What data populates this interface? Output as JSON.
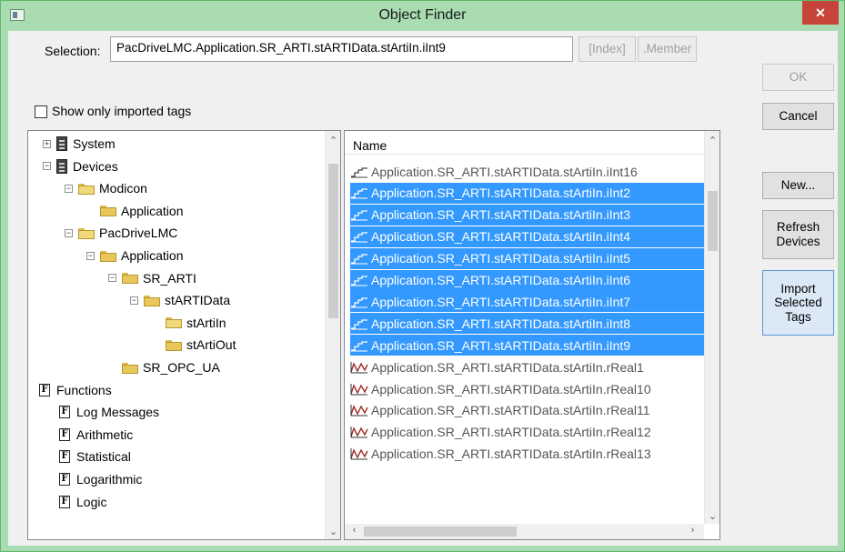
{
  "window": {
    "title": "Object Finder",
    "close_label": "✕"
  },
  "selection": {
    "label": "Selection:",
    "value": "PacDriveLMC.Application.SR_ARTI.stARTIData.stArtiIn.iInt9",
    "index_button": "[Index]",
    "member_button": ".Member"
  },
  "show_only_imported": {
    "label": "Show only imported tags",
    "checked": false
  },
  "buttons": {
    "ok": "OK",
    "cancel": "Cancel",
    "new": "New...",
    "refresh": "Refresh\nDevices",
    "import": "Import\nSelected\nTags"
  },
  "tree": [
    {
      "label": "System",
      "icon": "device-icon",
      "expander": "+",
      "indent": 0
    },
    {
      "label": "Devices",
      "icon": "device-icon",
      "expander": "−",
      "indent": 0
    },
    {
      "label": "Modicon",
      "icon": "folder-open-icon",
      "expander": "−",
      "indent": 1
    },
    {
      "label": "Application",
      "icon": "folder-icon",
      "expander": "",
      "indent": 2
    },
    {
      "label": "PacDriveLMC",
      "icon": "folder-open-icon",
      "expander": "−",
      "indent": 1
    },
    {
      "label": "Application",
      "icon": "folder-icon",
      "expander": "−",
      "indent": 2
    },
    {
      "label": "SR_ARTI",
      "icon": "folder-icon",
      "expander": "−",
      "indent": 3
    },
    {
      "label": "stARTIData",
      "icon": "folder-icon",
      "expander": "−",
      "indent": 4
    },
    {
      "label": "stArtiIn",
      "icon": "folder-open-icon",
      "expander": "",
      "indent": 5
    },
    {
      "label": "stArtiOut",
      "icon": "folder-icon",
      "expander": "",
      "indent": 5
    },
    {
      "label": "SR_OPC_UA",
      "icon": "folder-icon",
      "expander": "",
      "indent": 3
    },
    {
      "label": "Functions",
      "icon": "function-icon",
      "expander": "",
      "indent": 0
    },
    {
      "label": "Log Messages",
      "icon": "function-icon",
      "expander": "",
      "indent": 1
    },
    {
      "label": "Arithmetic",
      "icon": "function-icon",
      "expander": "",
      "indent": 1
    },
    {
      "label": "Statistical",
      "icon": "function-icon",
      "expander": "",
      "indent": 1
    },
    {
      "label": "Logarithmic",
      "icon": "function-icon",
      "expander": "",
      "indent": 1
    },
    {
      "label": "Logic",
      "icon": "function-icon",
      "expander": "",
      "indent": 1
    }
  ],
  "list": {
    "header": "Name",
    "rows": [
      {
        "name": "Application.SR_ARTI.stARTIData.stArtiIn.iInt16",
        "type": "int",
        "selected": false
      },
      {
        "name": "Application.SR_ARTI.stARTIData.stArtiIn.iInt2",
        "type": "int",
        "selected": true
      },
      {
        "name": "Application.SR_ARTI.stARTIData.stArtiIn.iInt3",
        "type": "int",
        "selected": true
      },
      {
        "name": "Application.SR_ARTI.stARTIData.stArtiIn.iInt4",
        "type": "int",
        "selected": true
      },
      {
        "name": "Application.SR_ARTI.stARTIData.stArtiIn.iInt5",
        "type": "int",
        "selected": true
      },
      {
        "name": "Application.SR_ARTI.stARTIData.stArtiIn.iInt6",
        "type": "int",
        "selected": true
      },
      {
        "name": "Application.SR_ARTI.stARTIData.stArtiIn.iInt7",
        "type": "int",
        "selected": true
      },
      {
        "name": "Application.SR_ARTI.stARTIData.stArtiIn.iInt8",
        "type": "int",
        "selected": true
      },
      {
        "name": "Application.SR_ARTI.stARTIData.stArtiIn.iInt9",
        "type": "int",
        "selected": true
      },
      {
        "name": "Application.SR_ARTI.stARTIData.stArtiIn.rReal1",
        "type": "real",
        "selected": false
      },
      {
        "name": "Application.SR_ARTI.stARTIData.stArtiIn.rReal10",
        "type": "real",
        "selected": false
      },
      {
        "name": "Application.SR_ARTI.stARTIData.stArtiIn.rReal11",
        "type": "real",
        "selected": false
      },
      {
        "name": "Application.SR_ARTI.stARTIData.stArtiIn.rReal12",
        "type": "real",
        "selected": false
      },
      {
        "name": "Application.SR_ARTI.stARTIData.stArtiIn.rReal13",
        "type": "real",
        "selected": false
      }
    ]
  },
  "colors": {
    "titlebar": "#a9dcb1",
    "close": "#c7443a",
    "selection": "#3399ff"
  }
}
